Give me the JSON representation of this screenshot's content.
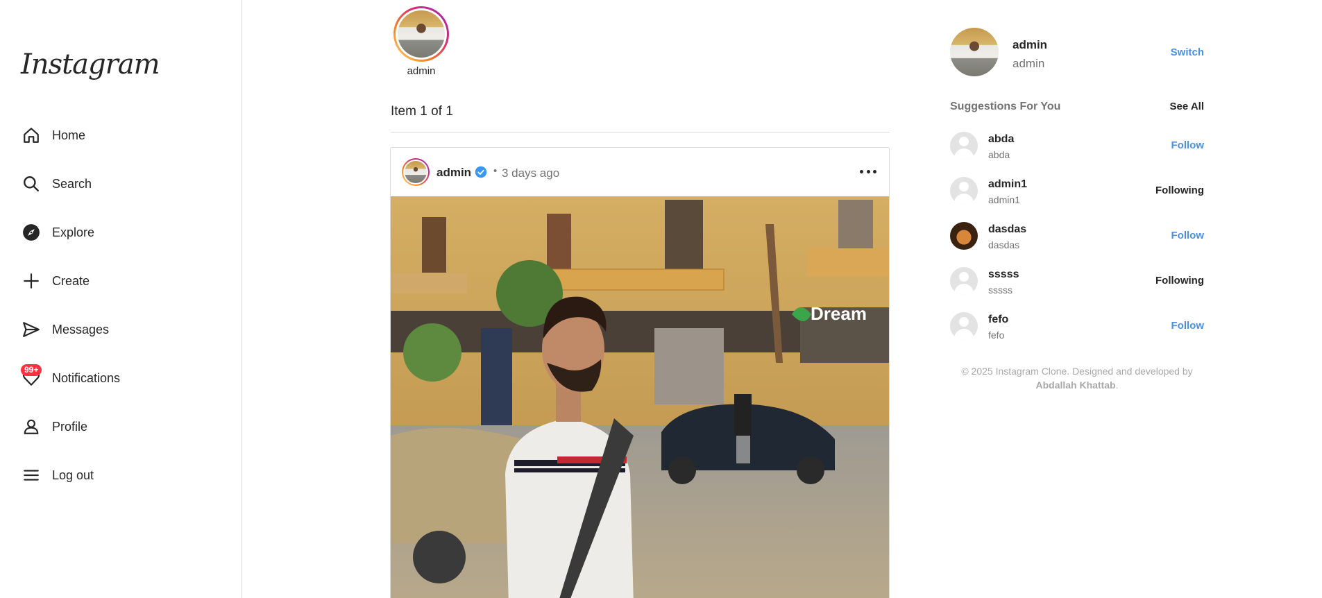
{
  "brand": {
    "logo_text": "Instagram"
  },
  "sidebar": {
    "items": [
      {
        "label": "Home",
        "icon": "home-icon"
      },
      {
        "label": "Search",
        "icon": "search-icon"
      },
      {
        "label": "Explore",
        "icon": "compass-icon"
      },
      {
        "label": "Create",
        "icon": "plus-icon"
      },
      {
        "label": "Messages",
        "icon": "paper-plane-icon"
      },
      {
        "label": "Notifications",
        "icon": "heart-icon",
        "badge": "99+"
      },
      {
        "label": "Profile",
        "icon": "user-icon"
      },
      {
        "label": "Log out",
        "icon": "menu-icon"
      }
    ]
  },
  "stories": [
    {
      "username": "admin"
    }
  ],
  "carousel": {
    "status": "Item 1 of 1"
  },
  "post": {
    "username": "admin",
    "verified": true,
    "separator": "•",
    "time": "3 days ago"
  },
  "current_user": {
    "username": "admin",
    "full_name": "admin",
    "switch_label": "Switch"
  },
  "suggestions": {
    "title": "Suggestions For You",
    "see_all_label": "See All",
    "items": [
      {
        "username": "abda",
        "subtitle": "abda",
        "action": "Follow"
      },
      {
        "username": "admin1",
        "subtitle": "admin1",
        "action": "Following"
      },
      {
        "username": "dasdas",
        "subtitle": "dasdas",
        "action": "Follow"
      },
      {
        "username": "sssss",
        "subtitle": "sssss",
        "action": "Following"
      },
      {
        "username": "fefo",
        "subtitle": "fefo",
        "action": "Follow"
      }
    ]
  },
  "footer": {
    "text": "© 2025 Instagram Clone. Designed and developed by",
    "author": "Abdallah Khattab",
    "period": "."
  },
  "colors": {
    "accent": "#4a90e2",
    "badge": "#ff3040",
    "border": "#dbdbdb",
    "muted": "#737373"
  }
}
